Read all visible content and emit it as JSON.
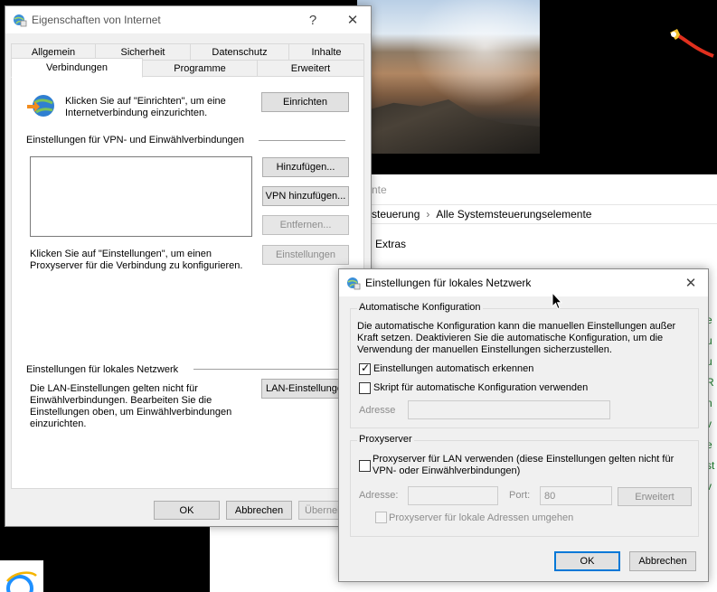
{
  "background": {
    "panel_title": "nte",
    "breadcrumb": [
      "steuerung",
      "Alle Systemsteuerungselemente"
    ],
    "menu_item": "Extras",
    "green_letters": [
      "e",
      "u",
      "u",
      "R",
      "n",
      "v",
      "e",
      "st",
      "v"
    ]
  },
  "internet_properties": {
    "title": "Eigenschaften von Internet",
    "help_glyph": "?",
    "close_glyph": "✕",
    "tabs_row1": [
      "Allgemein",
      "Sicherheit",
      "Datenschutz",
      "Inhalte"
    ],
    "tabs_row2": [
      "Verbindungen",
      "Programme",
      "Erweitert"
    ],
    "active_tab": "Verbindungen",
    "setup_text": "Klicken Sie auf \"Einrichten\", um eine Internetverbindung einzurichten.",
    "setup_button": "Einrichten",
    "vpn_section": "Einstellungen für VPN- und Einwählverbindungen",
    "add_button": "Hinzufügen...",
    "add_vpn_button": "VPN hinzufügen...",
    "remove_button": "Entfernen...",
    "settings_button": "Einstellungen",
    "proxy_text": "Klicken Sie auf \"Einstellungen\", um einen Proxyserver für die Verbindung zu konfigurieren.",
    "lan_section": "Einstellungen für lokales Netzwerk",
    "lan_text": "Die LAN-Einstellungen gelten nicht für Einwählverbindungen. Bearbeiten Sie die Einstellungen oben, um Einwählverbindungen einzurichten.",
    "lan_button": "LAN-Einstellungen",
    "ok": "OK",
    "cancel": "Abbrechen",
    "apply": "Übernehmen"
  },
  "lan_settings": {
    "title": "Einstellungen für lokales Netzwerk",
    "close_glyph": "✕",
    "auto_group": "Automatische Konfiguration",
    "auto_desc": "Die automatische Konfiguration kann die manuellen Einstellungen außer Kraft setzen. Deaktivieren Sie die automatische Konfiguration, um die Verwendung der manuellen Einstellungen sicherzustellen.",
    "auto_detect_label": "Einstellungen automatisch erkennen",
    "auto_detect_checked": true,
    "script_label": "Skript für automatische Konfiguration verwenden",
    "script_checked": false,
    "address_label": "Adresse",
    "address_value": "",
    "proxy_group": "Proxyserver",
    "proxy_label": "Proxyserver für LAN verwenden (diese Einstellungen gelten nicht für VPN- oder Einwählverbindungen)",
    "proxy_checked": false,
    "proxy_address_label": "Adresse:",
    "proxy_address_value": "",
    "port_label": "Port:",
    "port_value": "80",
    "advanced_button": "Erweitert",
    "bypass_label": "Proxyserver für lokale Adressen umgehen",
    "bypass_checked": false,
    "ok": "OK",
    "cancel": "Abbrechen"
  }
}
